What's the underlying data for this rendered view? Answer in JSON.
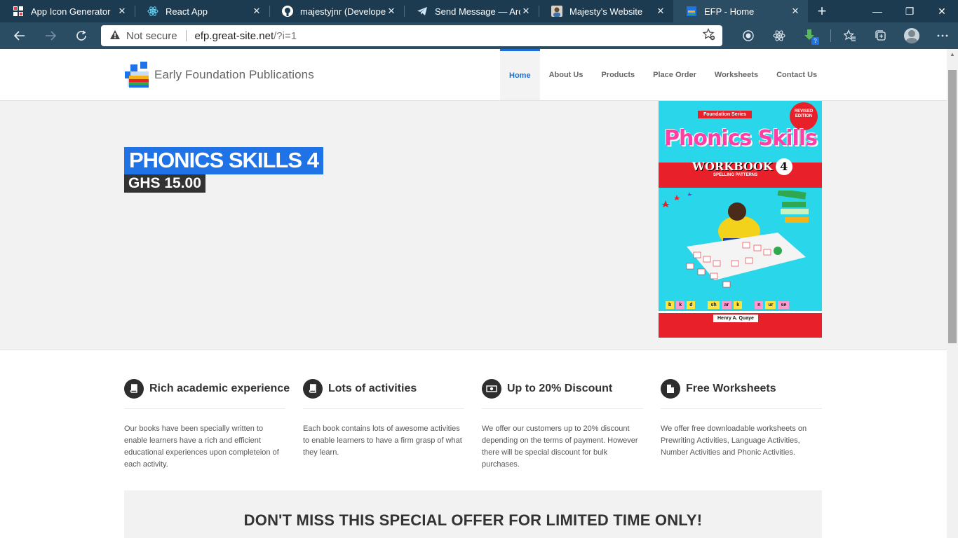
{
  "browser": {
    "tabs": [
      {
        "title": "App Icon Generator",
        "icon": "grid-favicon",
        "active": false
      },
      {
        "title": "React App",
        "icon": "react-favicon",
        "active": false
      },
      {
        "title": "majestyjnr (Developer M",
        "icon": "github-favicon",
        "active": false
      },
      {
        "title": "Send Message — Archi",
        "icon": "telegram-favicon",
        "active": false
      },
      {
        "title": "Majesty's Website",
        "icon": "profile-favicon",
        "active": false
      },
      {
        "title": "EFP - Home",
        "icon": "efp-favicon",
        "active": true
      }
    ],
    "new_tab": "+",
    "window_controls": {
      "minimize": "—",
      "maximize": "❐",
      "close": "✕"
    },
    "security_label": "Not secure",
    "url_host": "efp.great-site.net",
    "url_path": "/?i=1",
    "toolbar_icons": [
      "record-icon",
      "atom-icon",
      "download-icon",
      "favorites-icon",
      "collections-icon",
      "profile-icon",
      "more-icon"
    ],
    "extension_badge": "?"
  },
  "site": {
    "brand_name": "Early Foundation Publications",
    "logo_letters": "EFP",
    "nav": [
      {
        "label": "Home",
        "active": true
      },
      {
        "label": "About Us",
        "active": false
      },
      {
        "label": "Products",
        "active": false
      },
      {
        "label": "Place Order",
        "active": false
      },
      {
        "label": "Worksheets",
        "active": false
      },
      {
        "label": "Contact Us",
        "active": false
      }
    ]
  },
  "hero": {
    "title": "PHONICS SKILLS 4",
    "price": "GHS 15.00",
    "book": {
      "series": "Foundation Series",
      "seal": "REVISED EDITION",
      "title": "Phonics Skills",
      "workbook": "WORKBOOK",
      "number": "4",
      "subtitle": "SPELLING PATTERNS",
      "letters": [
        "b",
        "k",
        "d",
        "sh",
        "ar",
        "k",
        "n",
        "ur",
        "se"
      ],
      "author": "Henry A. Quaye"
    }
  },
  "features": [
    {
      "icon": "book-icon",
      "title": "Rich academic experience",
      "text": "Our books have been specially written to enable learners have a rich and efficient educational experiences upon completeion of each activity."
    },
    {
      "icon": "book-icon",
      "title": "Lots of activities",
      "text": "Each book contains lots of awesome activities to enable learners to have a firm grasp of what they learn."
    },
    {
      "icon": "money-icon",
      "title": "Up to 20% Discount",
      "text": "We offer our customers up to 20% discount depending on the terms of payment. However there will be special discount for bulk purchases."
    },
    {
      "icon": "file-icon",
      "title": "Free Worksheets",
      "text": "We offer free downloadable worksheets on Prewriting Activities, Language Activities, Number Activities and Phonic Activities."
    }
  ],
  "offer": {
    "title": "DON'T MISS THIS SPECIAL OFFER FOR LIMITED TIME ONLY!"
  },
  "colors": {
    "chrome_dark": "#1c3b50",
    "chrome_toolbar": "#2b4d64",
    "accent": "#1f73e7",
    "nav_active": "#1b6fd6",
    "book_cyan": "#2ad7ea",
    "book_red": "#e8202a"
  }
}
